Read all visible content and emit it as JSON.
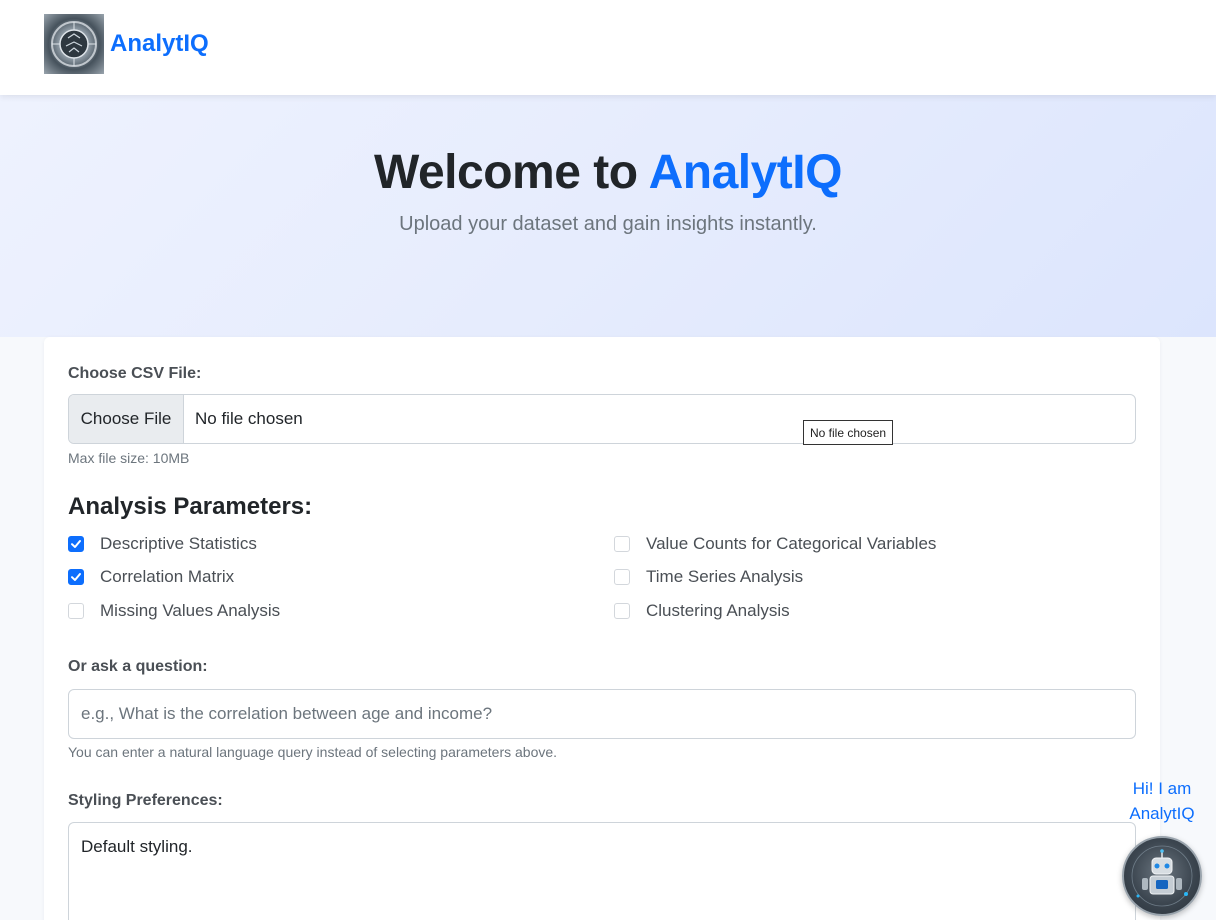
{
  "header": {
    "brand_name": "AnalytIQ",
    "logo_icon": "circuit-brain-logo"
  },
  "hero": {
    "title_prefix": "Welcome to ",
    "title_accent": "AnalytIQ",
    "subtitle": "Upload your dataset and gain insights instantly."
  },
  "upload": {
    "label": "Choose CSV File:",
    "button_label": "Choose File",
    "status": "No file chosen",
    "tooltip": "No file chosen",
    "help": "Max file size: 10MB"
  },
  "analysis": {
    "title": "Analysis Parameters:",
    "options": [
      {
        "label": "Descriptive Statistics",
        "checked": true
      },
      {
        "label": "Correlation Matrix",
        "checked": true
      },
      {
        "label": "Missing Values Analysis",
        "checked": false
      },
      {
        "label": "Value Counts for Categorical Variables",
        "checked": false
      },
      {
        "label": "Time Series Analysis",
        "checked": false
      },
      {
        "label": "Clustering Analysis",
        "checked": false
      }
    ]
  },
  "question": {
    "label": "Or ask a question:",
    "placeholder": "e.g., What is the correlation between age and income?",
    "help": "You can enter a natural language query instead of selecting parameters above."
  },
  "styling": {
    "label": "Styling Preferences:",
    "value": "Default styling."
  },
  "chatbot": {
    "greeting_line1": "Hi! I am",
    "greeting_line2": "AnalytIQ",
    "avatar_icon": "robot-avatar-icon"
  },
  "colors": {
    "accent": "#0d6efd",
    "hero_bg": "#e6ecfd",
    "page_bg": "#f7f9fc"
  }
}
